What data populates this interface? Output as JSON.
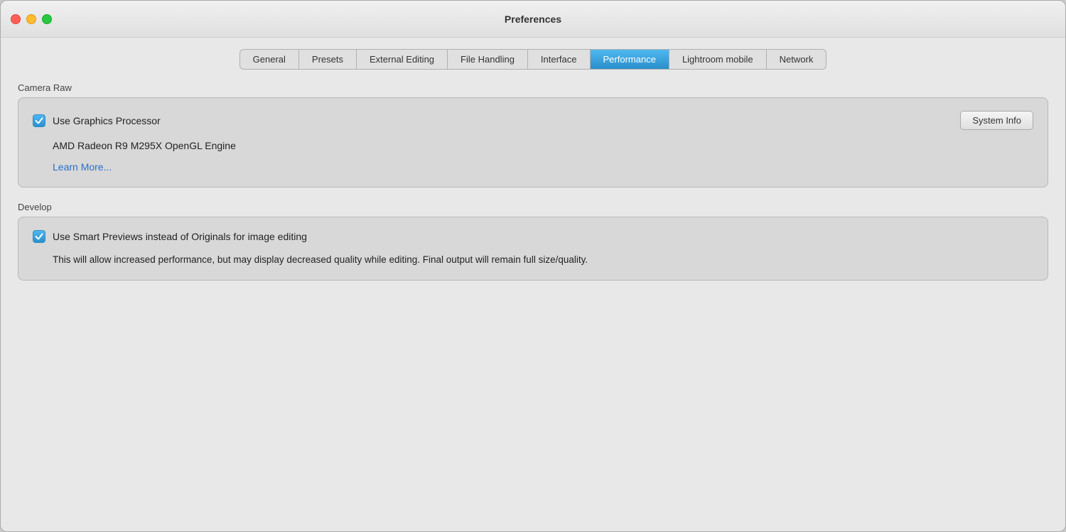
{
  "window": {
    "title": "Preferences"
  },
  "traffic_lights": {
    "close_label": "close",
    "minimize_label": "minimize",
    "maximize_label": "maximize"
  },
  "tabs": [
    {
      "id": "general",
      "label": "General",
      "active": false
    },
    {
      "id": "presets",
      "label": "Presets",
      "active": false
    },
    {
      "id": "external-editing",
      "label": "External Editing",
      "active": false
    },
    {
      "id": "file-handling",
      "label": "File Handling",
      "active": false
    },
    {
      "id": "interface",
      "label": "Interface",
      "active": false
    },
    {
      "id": "performance",
      "label": "Performance",
      "active": true
    },
    {
      "id": "lightroom-mobile",
      "label": "Lightroom mobile",
      "active": false
    },
    {
      "id": "network",
      "label": "Network",
      "active": false
    }
  ],
  "sections": {
    "camera_raw": {
      "label": "Camera Raw",
      "use_graphics_processor": {
        "checkbox_checked": true,
        "label": "Use Graphics Processor"
      },
      "system_info_button": "System Info",
      "gpu_name": "AMD Radeon R9 M295X OpenGL Engine",
      "learn_more_link": "Learn More..."
    },
    "develop": {
      "label": "Develop",
      "use_smart_previews": {
        "checkbox_checked": true,
        "label": "Use Smart Previews instead of Originals for image editing"
      },
      "description": "This will allow increased performance, but may display decreased quality while editing. Final output will remain full size/quality."
    }
  }
}
